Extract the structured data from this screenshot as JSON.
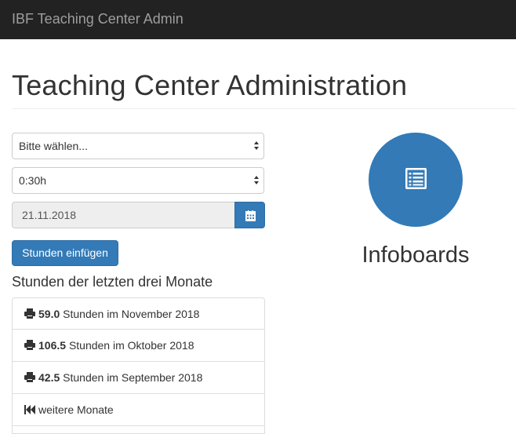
{
  "navbar": {
    "brand": "IBF Teaching Center Admin"
  },
  "page": {
    "title": "Teaching Center Administration"
  },
  "form": {
    "category_select": {
      "value": "Bitte wählen..."
    },
    "duration_select": {
      "value": "0:30h"
    },
    "date_input": {
      "value": "21.11.2018",
      "icon": "calendar-icon"
    },
    "submit_label": "Stunden einfügen"
  },
  "hours": {
    "heading": "Stunden der letzten drei Monate",
    "items": [
      {
        "value": "59.0",
        "text": "Stunden im November 2018",
        "icon": "print-icon"
      },
      {
        "value": "106.5",
        "text": "Stunden im Oktober 2018",
        "icon": "print-icon"
      },
      {
        "value": "42.5",
        "text": "Stunden im September 2018",
        "icon": "print-icon"
      }
    ],
    "more_label": "weitere Monate",
    "more_icon": "fast-backward-icon"
  },
  "infoboards": {
    "label": "Infoboards",
    "icon": "list-alt-icon",
    "color": "#337ab7"
  }
}
